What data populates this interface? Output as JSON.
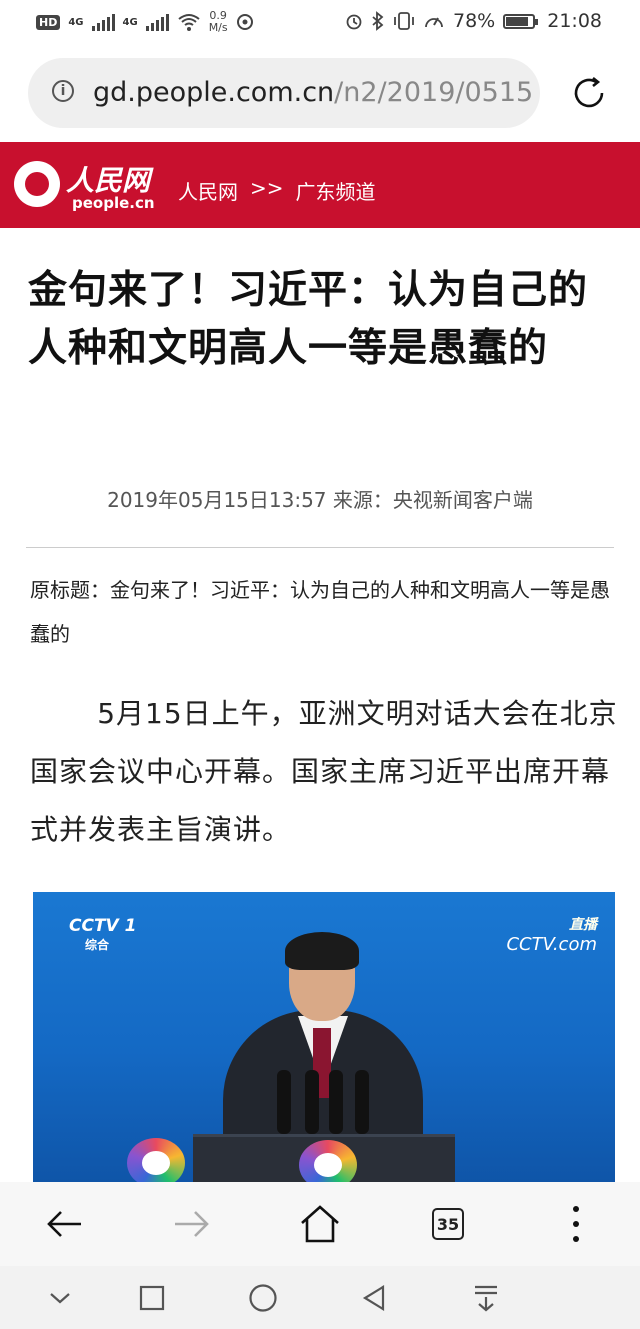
{
  "status_bar": {
    "left_badge": "HD",
    "net1": "4G",
    "net2": "4G",
    "speed_value": "0.9",
    "speed_unit": "M/s",
    "battery_text": "78%",
    "battery_level": 0.78,
    "time": "21:08"
  },
  "address_bar": {
    "host": "gd.people.com.cn",
    "path": "/n2/2019/0515/"
  },
  "site_header": {
    "logo_cn": "人民网",
    "logo_en": "people.cn",
    "crumb_site": "人民网",
    "crumb_sep": ">>",
    "crumb_channel": "广东频道",
    "brand_color": "#c8102e"
  },
  "article": {
    "title": "金句来了！习近平：认为自己的人种和文明高人一等是愚蠢的",
    "meta": "2019年05月15日13:57  来源：央视新闻客户端",
    "original_title": "原标题：金句来了！习近平：认为自己的人种和文明高人一等是愚蠢的",
    "paragraph": "5月15日上午，亚洲文明对话大会在北京国家会议中心开幕。国家主席习近平出席开幕式并发表主旨演讲。"
  },
  "photo": {
    "channel_logo": "CCTV 1",
    "channel_sub": "综合",
    "live_label": "直播",
    "live_logo": "CCTV.com"
  },
  "browser_toolbar": {
    "tab_count": "35",
    "icons": [
      "back-arrow-icon",
      "forward-arrow-icon",
      "home-icon",
      "tabs-icon",
      "more-menu-icon"
    ]
  },
  "nav_bar": {
    "icons": [
      "collapse-chevron-icon",
      "recent-apps-icon",
      "home-circle-icon",
      "back-triangle-icon",
      "notification-pull-icon"
    ]
  }
}
